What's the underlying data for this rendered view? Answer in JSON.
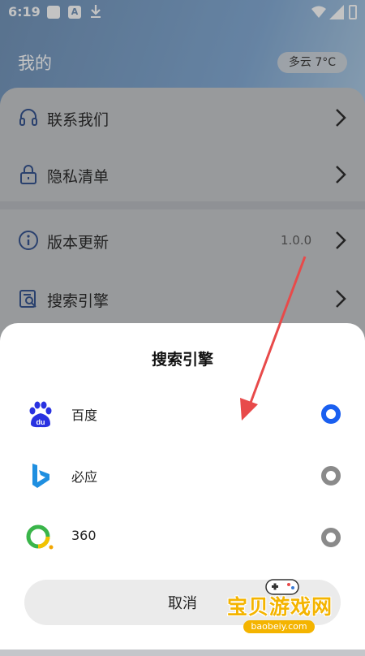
{
  "status_bar": {
    "time": "6:19",
    "notif_icon_a": "A"
  },
  "header": {
    "title": "我的",
    "weather": "多云 7°C"
  },
  "menu": {
    "items": [
      {
        "label": "联系我们",
        "icon": "headset-icon"
      },
      {
        "label": "隐私清单",
        "icon": "lock-icon"
      },
      {
        "label": "版本更新",
        "icon": "info-icon",
        "value": "1.0.0"
      },
      {
        "label": "搜索引擎",
        "icon": "search-doc-icon"
      }
    ]
  },
  "sheet": {
    "title": "搜索引擎",
    "options": [
      {
        "label": "百度",
        "logo": "baidu-logo",
        "selected": true
      },
      {
        "label": "必应",
        "logo": "bing-logo",
        "selected": false
      },
      {
        "label": "360",
        "logo": "360-logo",
        "selected": false
      }
    ],
    "cancel_label": "取消"
  },
  "watermark": {
    "text": "宝贝游戏网",
    "url": "baobeiy.com"
  },
  "colors": {
    "accent": "#1a5ff0",
    "arrow": "#e84a4a",
    "watermark": "#f4b400"
  }
}
